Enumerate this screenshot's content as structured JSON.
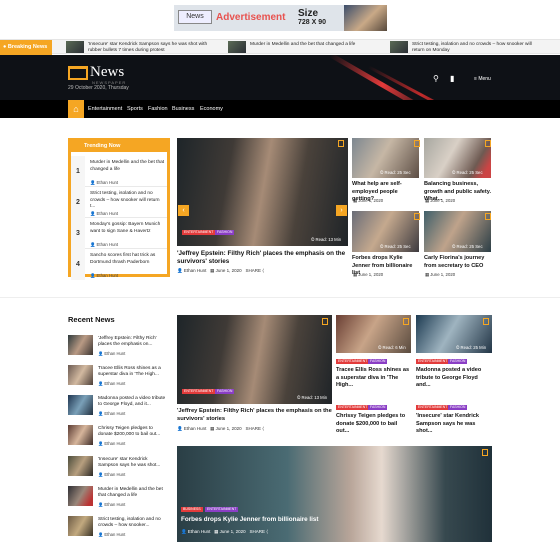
{
  "ad": {
    "logo": "News",
    "text": "Advertisement",
    "size_label": "Size",
    "size_value": "728 X 90"
  },
  "breaking": {
    "label": "Breaking News",
    "items": [
      "'Insecure' star Kendrick Sampson says he was shot with rubber bullets 7 times during protest",
      "Murder in Medellin and the bet that changed a life",
      "Strict testing, isolation and no crowds – how snooker will return on Monday"
    ]
  },
  "header": {
    "logo": "News",
    "logo_sub": "NEWSPAPER",
    "date": "29 October 2020, Thursday",
    "menu_label": "Menu"
  },
  "nav": {
    "home_icon": "home-icon",
    "items": [
      "Entertainment",
      "Sports",
      "Fashion",
      "Business",
      "Economy"
    ]
  },
  "trending": {
    "title": "Trending Now",
    "items": [
      {
        "num": "1",
        "title": "Murder in Medellin and the bet that changed a life",
        "author": "Ethan Hunt"
      },
      {
        "num": "2",
        "title": "Strict testing, isolation and no crowds – how snooker will return t...",
        "author": "Ethan Hunt"
      },
      {
        "num": "3",
        "title": "Monday's gossip: Bayern Munich want to sign Sane & Havertz",
        "author": "Ethan Hunt"
      },
      {
        "num": "4",
        "title": "Sancho scores first hat trick as Dortmund thrash Paderborn",
        "author": "Ethan Hunt"
      }
    ]
  },
  "featured": {
    "badges": [
      "Entertainment",
      "Fashion"
    ],
    "read": "Read: 13 Min",
    "title": "'Jeffrey Epstein: Filthy Rich' places the emphasis on the survivors' stories",
    "author": "Ethan Hunt",
    "date": "June 1, 2020",
    "share": "SHARE"
  },
  "cards": [
    {
      "read": "Read:",
      "date": "25 Sec",
      "title": "What help are self-employed people getting?",
      "pub": "June 1, 2020"
    },
    {
      "read": "Read:",
      "date": "25 Sec",
      "title": "Balancing business, growth and public safety. What...",
      "pub": "June 1, 2020"
    },
    {
      "read": "Read:",
      "date": "25 Sec",
      "title": "Forbes drops Kylie Jenner from billionaire list",
      "pub": "June 1, 2020"
    },
    {
      "read": "Read:",
      "date": "25 Sec",
      "title": "Carly Fiorina's journey from secretary to CEO",
      "pub": "June 1, 2020"
    }
  ],
  "recent": {
    "title": "Recent News",
    "items": [
      {
        "title": "'Jeffrey Epstein: Filthy Rich' places the emphasis on...",
        "author": "Ethan Hunt"
      },
      {
        "title": "Tracee Ellis Ross shines as a superstar diva in 'The High...",
        "author": "Ethan Hunt"
      },
      {
        "title": "Madonna posted a video tribute to George Floyd, and it...",
        "author": "Ethan Hunt"
      },
      {
        "title": "Chrissy Teigen pledges to donate $200,000 to bail out...",
        "author": "Ethan Hunt"
      },
      {
        "title": "'Insecure' star Kendrick Sampson says he was shot...",
        "author": "Ethan Hunt"
      },
      {
        "title": "Murder in Medellin and the bet that changed a life",
        "author": "Ethan Hunt"
      },
      {
        "title": "Strict testing, isolation and no crowds – how snooker...",
        "author": "Ethan Hunt"
      }
    ]
  },
  "grid": {
    "main": {
      "badges": [
        "Entertainment",
        "Fashion"
      ],
      "read": "Read: 13 Min",
      "title": "'Jeffrey Epstein: Filthy Rich' places the emphasis on the survivors' stories",
      "author": "Ethan Hunt",
      "date": "June 1, 2020",
      "share": "SHARE"
    },
    "a": {
      "read": "Read: 6 Min",
      "badges": [
        "Entertainment",
        "Fashion"
      ],
      "title": "Tracee Ellis Ross shines as a superstar diva in 'The High...",
      "b2": [
        "Entertainment",
        "Fashion"
      ],
      "title2": "Chrissy Teigen pledges to donate $200,000 to bail out..."
    },
    "b": {
      "read": "Read: 25 Min",
      "badges": [
        "Entertainment",
        "Fashion"
      ],
      "title": "Madonna posted a video tribute to George Floyd and...",
      "b2": [
        "Entertainment",
        "Fashion"
      ],
      "title2": "'Insecure' star Kendrick Sampson says he was shot..."
    },
    "bottom": {
      "badges": [
        "Business",
        "Entertainment"
      ],
      "title": "Forbes drops Kylie Jenner from billionaire list",
      "author": "Ethan Hunt",
      "date": "June 1, 2020",
      "share": "SHARE"
    }
  }
}
